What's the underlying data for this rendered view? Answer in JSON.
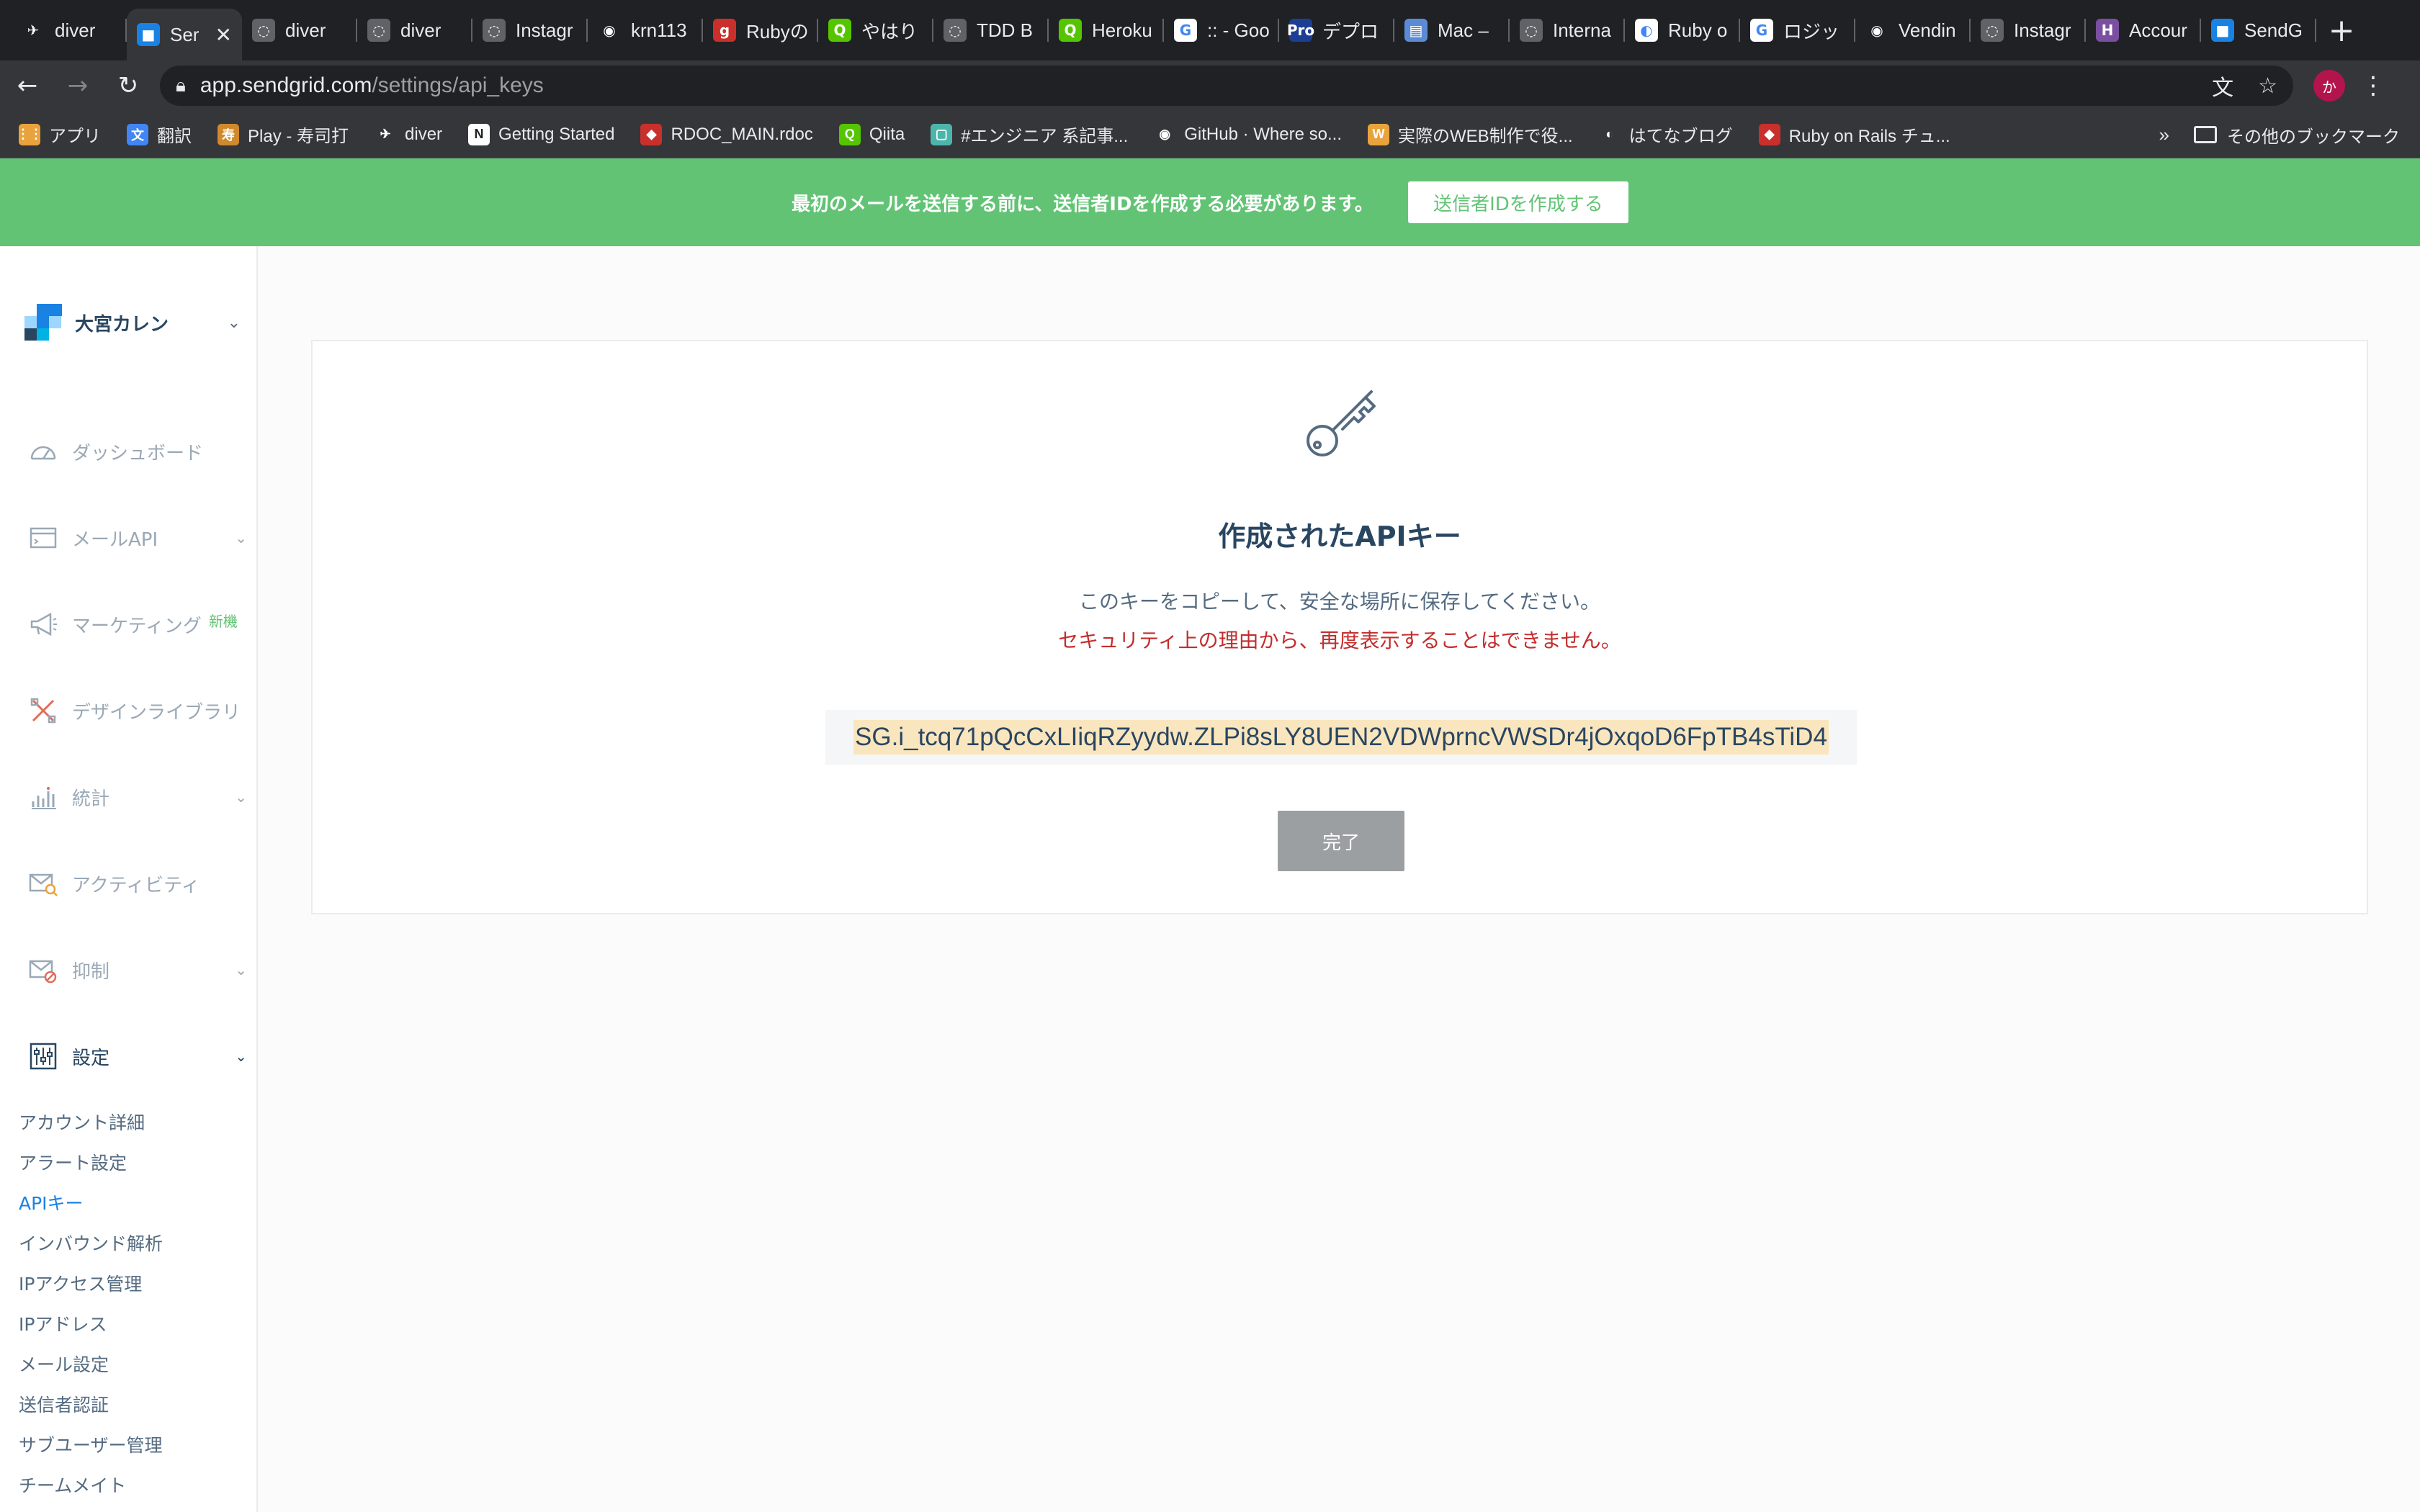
{
  "browser": {
    "tabs": [
      {
        "title": "diver",
        "fav_color": "#202124",
        "fav_glyph": "✈"
      },
      {
        "title": "Ser",
        "fav_color": "#1a82e2",
        "fav_glyph": "■"
      },
      {
        "title": "diver",
        "fav_color": "#5f6368",
        "fav_glyph": "◌"
      },
      {
        "title": "diver",
        "fav_color": "#5f6368",
        "fav_glyph": "◌"
      },
      {
        "title": "Instagr",
        "fav_color": "#5f6368",
        "fav_glyph": "◌"
      },
      {
        "title": "krn113",
        "fav_color": "#202124",
        "fav_glyph": "◉"
      },
      {
        "title": "Rubyの",
        "fav_color": "#c9302c",
        "fav_glyph": "g"
      },
      {
        "title": "やはり",
        "fav_color": "#55c500",
        "fav_glyph": "Q"
      },
      {
        "title": "TDD B",
        "fav_color": "#5f6368",
        "fav_glyph": "◌"
      },
      {
        "title": "Heroku",
        "fav_color": "#55c500",
        "fav_glyph": "Q"
      },
      {
        "title": ":: - Goo",
        "fav_color": "#ffffff",
        "fav_glyph": "G"
      },
      {
        "title": "デプロ",
        "fav_color": "#1c3f94",
        "fav_glyph": "Pro"
      },
      {
        "title": "Mac –",
        "fav_color": "#5c8bd6",
        "fav_glyph": "▤"
      },
      {
        "title": "Interna",
        "fav_color": "#5f6368",
        "fav_glyph": "◌"
      },
      {
        "title": "Ruby o",
        "fav_color": "#ffffff",
        "fav_glyph": "◐"
      },
      {
        "title": "ロジッ",
        "fav_color": "#ffffff",
        "fav_glyph": "G"
      },
      {
        "title": "Vendin",
        "fav_color": "#202124",
        "fav_glyph": "◉"
      },
      {
        "title": "Instagr",
        "fav_color": "#5f6368",
        "fav_glyph": "◌"
      },
      {
        "title": "Accour",
        "fav_color": "#7a4fa0",
        "fav_glyph": "H"
      },
      {
        "title": "SendG",
        "fav_color": "#1a82e2",
        "fav_glyph": "■"
      }
    ],
    "active_tab_index": 1,
    "new_tab_label": "+",
    "close_label": "✕",
    "url_host": "app.sendgrid.com",
    "url_path": "/settings/api_keys",
    "profile_initial": "か",
    "bookmarks": [
      {
        "label": "アプリ",
        "icon": "apps-grid-icon",
        "color": "#e8a33d",
        "glyph": "⋮⋮"
      },
      {
        "label": "翻訳",
        "icon": "translate-icon",
        "color": "#4285f4",
        "glyph": "文"
      },
      {
        "label": "Play - 寿司打",
        "icon": "sushida-icon",
        "color": "#d08a2c",
        "glyph": "寿"
      },
      {
        "label": "diver",
        "icon": "diver-icon",
        "color": "#35363a",
        "glyph": "✈"
      },
      {
        "label": "Getting Started",
        "icon": "notion-icon",
        "color": "#ffffff",
        "glyph": "N"
      },
      {
        "label": "RDOC_MAIN.rdoc",
        "icon": "ruby-icon",
        "color": "#c9302c",
        "glyph": "◆"
      },
      {
        "label": "Qiita",
        "icon": "qiita-icon",
        "color": "#55c500",
        "glyph": "Q"
      },
      {
        "label": "#エンジニア 系記事...",
        "icon": "bookmark-page-icon",
        "color": "#4db6ac",
        "glyph": "▢"
      },
      {
        "label": "GitHub · Where so...",
        "icon": "github-icon",
        "color": "#35363a",
        "glyph": "◉"
      },
      {
        "label": "実際のWEB制作で役...",
        "icon": "w-icon",
        "color": "#e8a33d",
        "glyph": "W"
      },
      {
        "label": "はてなブログ",
        "icon": "hatena-icon",
        "color": "#35363a",
        "glyph": "◐"
      },
      {
        "label": "Ruby on Rails チュ...",
        "icon": "rails-icon",
        "color": "#c9302c",
        "glyph": "◆"
      }
    ],
    "bookmarks_more": "»",
    "other_bookmarks": "その他のブックマーク"
  },
  "banner": {
    "text": "最初のメールを送信する前に、送信者IDを作成する必要があります。",
    "button": "送信者IDを作成する"
  },
  "sidebar": {
    "account_name": "大宮カレン",
    "nav": [
      {
        "label": "ダッシュボード",
        "icon": "dashboard-gauge-icon",
        "chevron": false
      },
      {
        "label": "メールAPI",
        "icon": "email-api-icon",
        "chevron": true
      },
      {
        "label": "マーケティング",
        "icon": "megaphone-icon",
        "chevron": false,
        "badge": "新機"
      },
      {
        "label": "デザインライブラリ",
        "icon": "design-tools-icon",
        "chevron": false
      },
      {
        "label": "統計",
        "icon": "stats-chart-icon",
        "chevron": true
      },
      {
        "label": "アクティビティ",
        "icon": "activity-search-icon",
        "chevron": false
      },
      {
        "label": "抑制",
        "icon": "suppression-mail-icon",
        "chevron": true
      },
      {
        "label": "設定",
        "icon": "settings-sliders-icon",
        "chevron": true
      }
    ],
    "settings_sub": [
      "アカウント詳細",
      "アラート設定",
      "APIキー",
      "インバウンド解析",
      "IPアクセス管理",
      "IPアドレス",
      "メール設定",
      "送信者認証",
      "サブユーザー管理",
      "チームメイト"
    ],
    "current_sub_index": 2
  },
  "main": {
    "icon": "key-icon",
    "title": "作成されたAPIキー",
    "description": "このキーをコピーして、安全な場所に保存してください。",
    "warning": "セキュリティ上の理由から、再度表示することはできません。",
    "api_key": "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",
    "done_button": "完了"
  },
  "colors": {
    "banner_green": "#62c375",
    "link_blue": "#1a82e2",
    "warning_red": "#c42d2d",
    "key_highlight": "#fae6be",
    "done_gray": "#9b9fa2"
  }
}
